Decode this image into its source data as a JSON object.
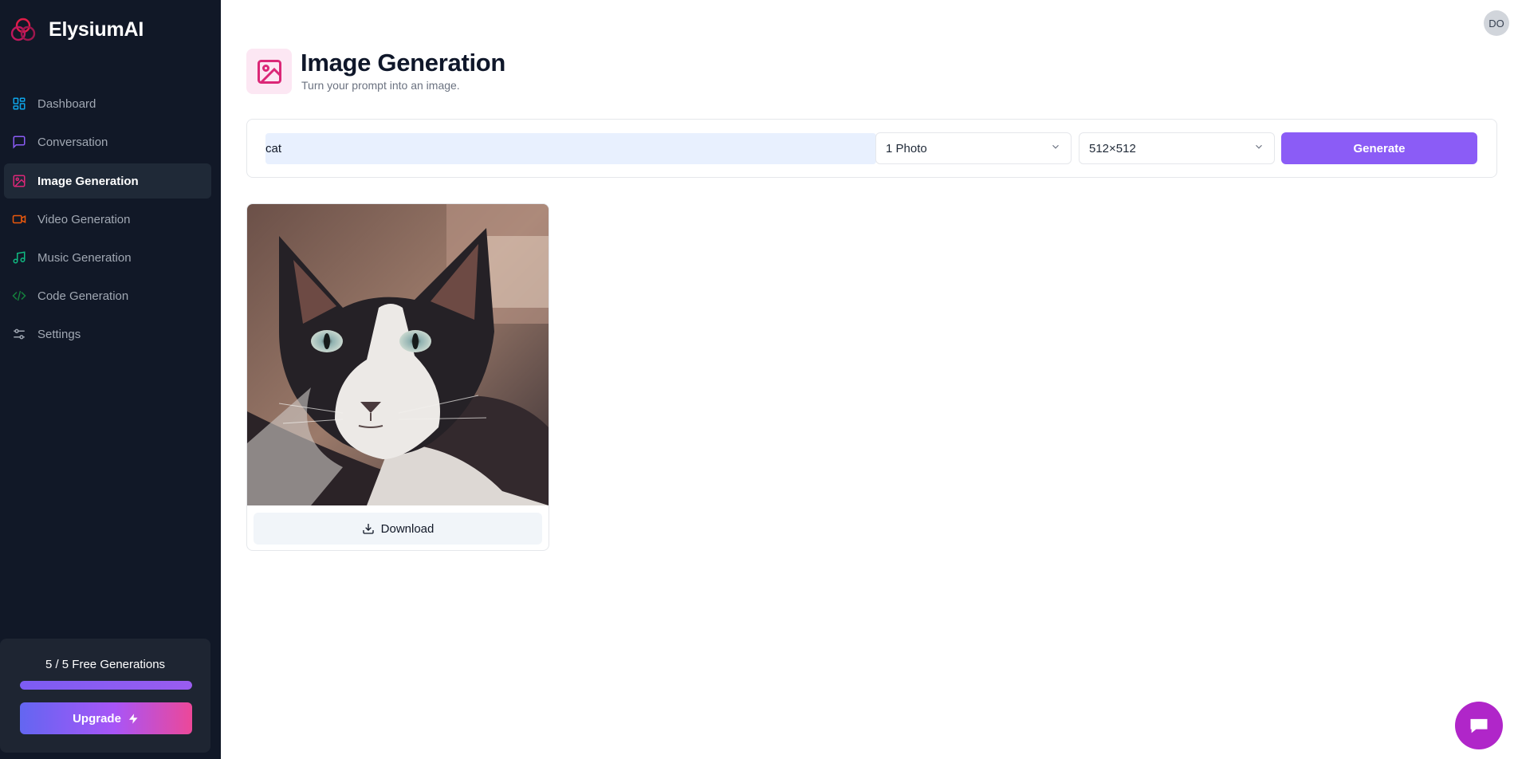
{
  "brand": {
    "name": "ElysiumAI"
  },
  "sidebar": {
    "items": [
      {
        "label": "Dashboard",
        "icon": "dashboard-icon",
        "color": "#0ea5e9"
      },
      {
        "label": "Conversation",
        "icon": "message-icon",
        "color": "#8b5cf6"
      },
      {
        "label": "Image Generation",
        "icon": "image-icon",
        "color": "#db2777",
        "active": true
      },
      {
        "label": "Video Generation",
        "icon": "video-icon",
        "color": "#ea580c"
      },
      {
        "label": "Music Generation",
        "icon": "music-icon",
        "color": "#10b981"
      },
      {
        "label": "Code Generation",
        "icon": "code-icon",
        "color": "#15803d"
      },
      {
        "label": "Settings",
        "icon": "settings-icon",
        "color": "#9ca3af"
      }
    ],
    "quota": {
      "text": "5 / 5 Free Generations",
      "progress": 1.0,
      "upgrade_label": "Upgrade"
    }
  },
  "header": {
    "avatar": "DO",
    "title": "Image Generation",
    "subtitle": "Turn your prompt into an image."
  },
  "form": {
    "prompt_value": "cat",
    "amount_value": "1 Photo",
    "resolution_value": "512×512",
    "generate_label": "Generate"
  },
  "results": [
    {
      "download_label": "Download"
    }
  ],
  "colors": {
    "sidebar_bg": "#111827",
    "accent": "#8b5cf6",
    "image_accent": "#db2777",
    "chat_fab": "#b026c9"
  }
}
